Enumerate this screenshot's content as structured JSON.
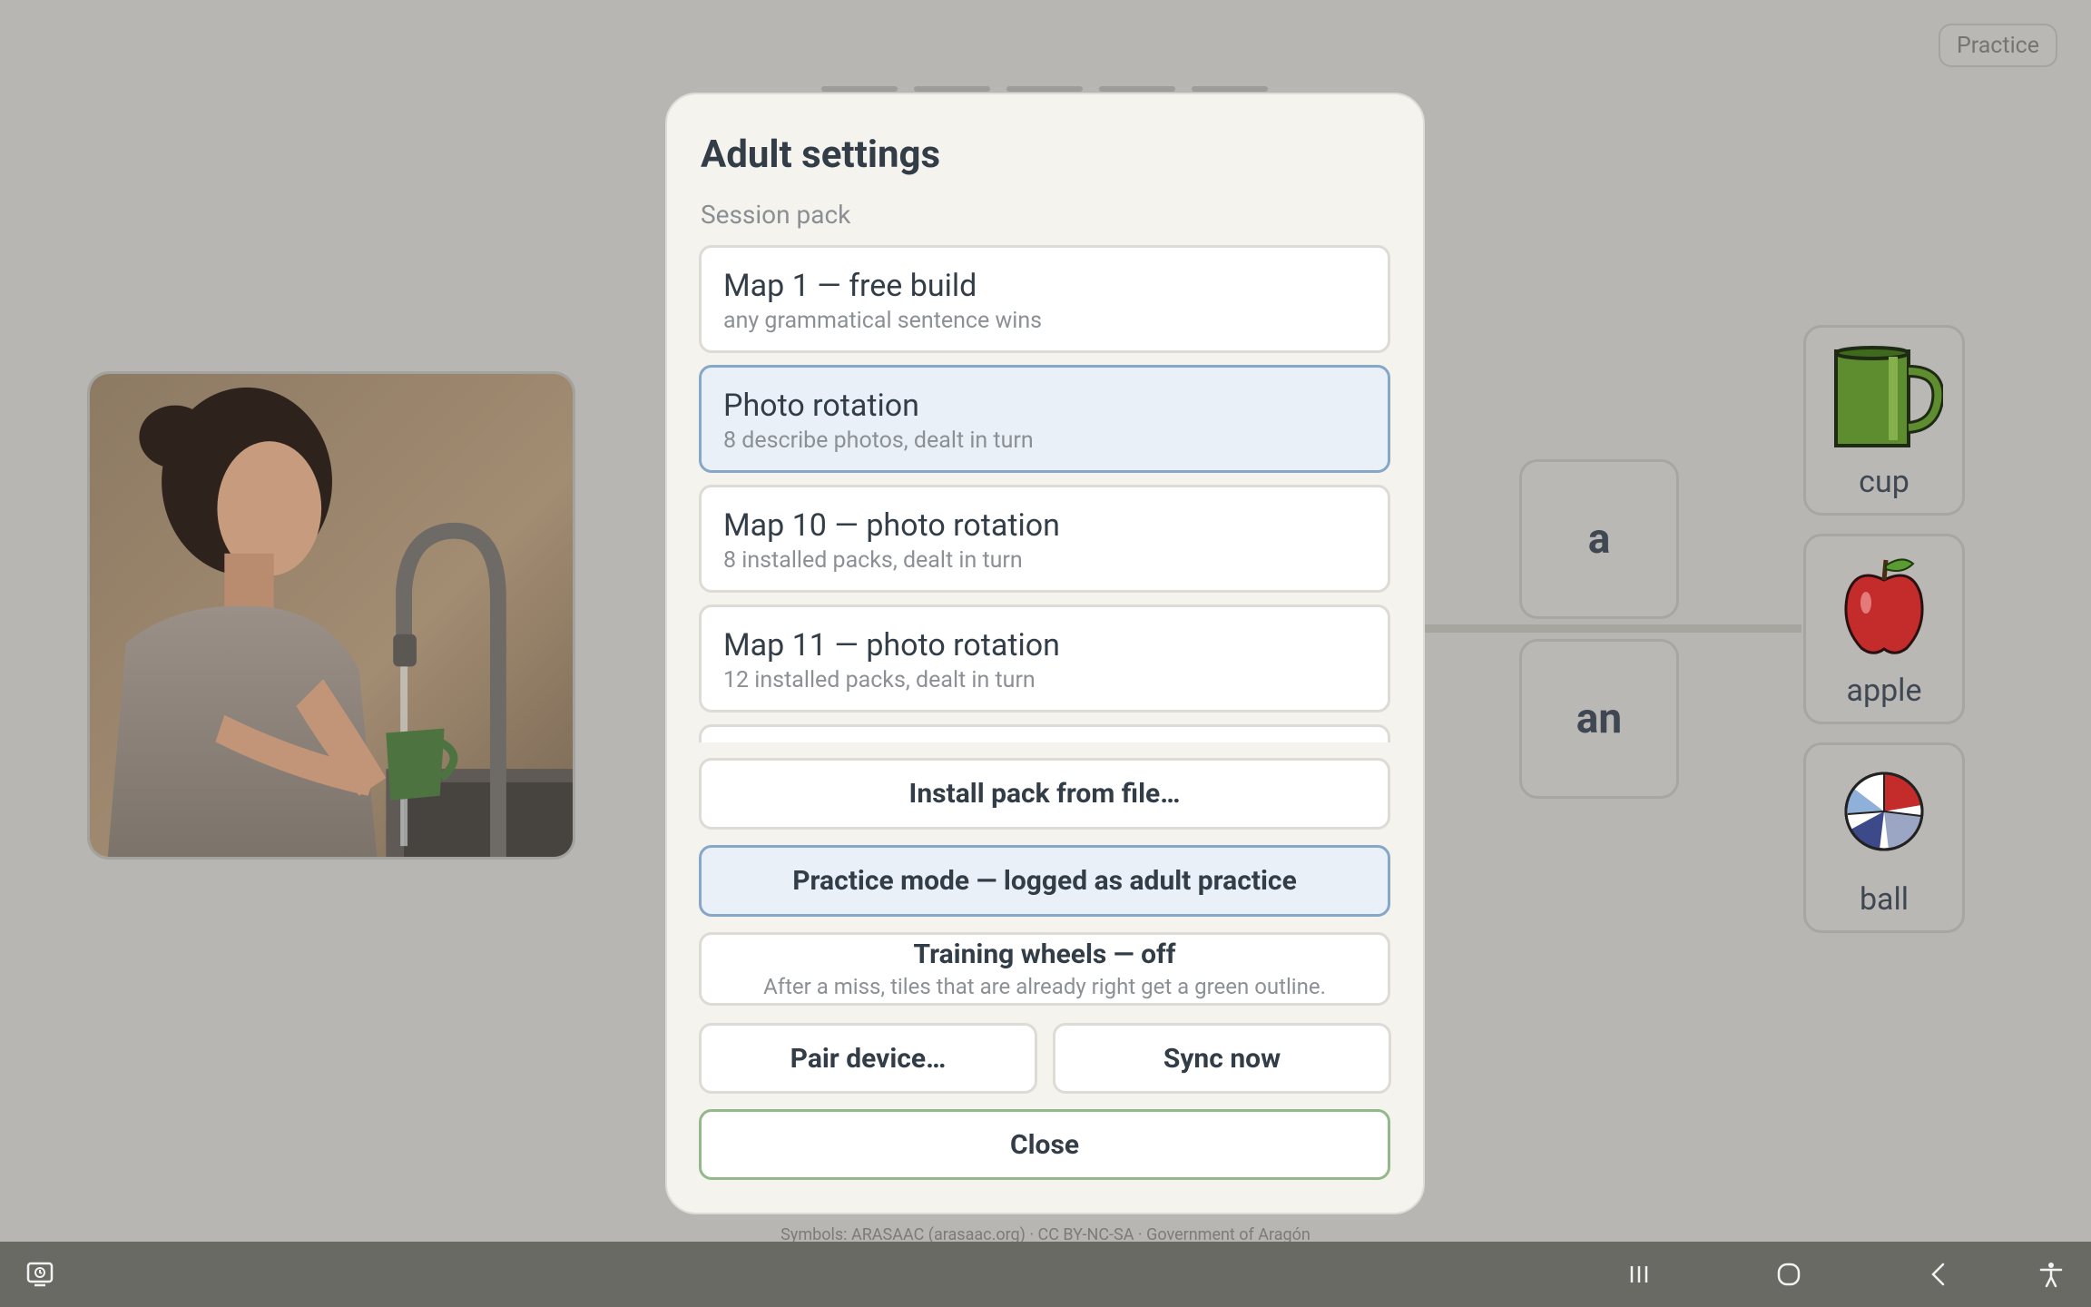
{
  "header": {
    "practice_label": "Practice"
  },
  "board": {
    "word_tiles": [
      "a",
      "an"
    ],
    "picture_tiles": [
      {
        "label": "cup",
        "icon": "cup-icon"
      },
      {
        "label": "apple",
        "icon": "apple-icon"
      },
      {
        "label": "ball",
        "icon": "ball-icon"
      }
    ]
  },
  "attribution": "Symbols: ARASAAC (arasaac.org) · CC BY-NC-SA · Government of Aragón",
  "modal": {
    "title": "Adult settings",
    "section_label": "Session pack",
    "packs": [
      {
        "title": "Map 1 — free build",
        "subtitle": "any grammatical sentence wins",
        "selected": false
      },
      {
        "title": "Photo rotation",
        "subtitle": "8 describe photos, dealt in turn",
        "selected": true
      },
      {
        "title": "Map 10 — photo rotation",
        "subtitle": "8 installed packs, dealt in turn",
        "selected": false
      },
      {
        "title": "Map 11 — photo rotation",
        "subtitle": "12 installed packs, dealt in turn",
        "selected": false
      }
    ],
    "install_label": "Install pack from file…",
    "practice_mode_label": "Practice mode — logged as adult practice",
    "training_wheels_label": "Training wheels — off",
    "training_wheels_desc": "After a miss, tiles that are already right get a green outline.",
    "pair_label": "Pair device…",
    "sync_label": "Sync now",
    "close_label": "Close"
  },
  "colors": {
    "backdrop": "#b7b6b2",
    "selected_fill": "#e9f0f8",
    "selected_border": "#87a7c8",
    "close_border": "#93b88a",
    "navbar": "#6a6a64"
  }
}
